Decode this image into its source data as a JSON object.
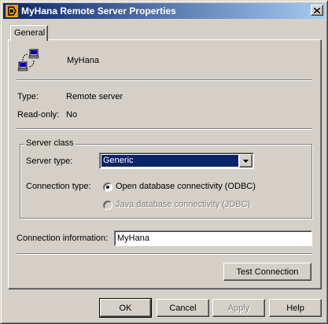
{
  "window": {
    "title": "MyHana Remote Server Properties"
  },
  "tabs": [
    {
      "label": "General"
    }
  ],
  "general": {
    "server_name": "MyHana",
    "type_label": "Type:",
    "type_value": "Remote server",
    "readonly_label": "Read-only:",
    "readonly_value": "No"
  },
  "server_class": {
    "group_label": "Server class",
    "server_type_label": "Server type:",
    "server_type_value": "Generic",
    "connection_type_label": "Connection type:",
    "options": [
      {
        "label": "Open database connectivity (ODBC)",
        "selected": true,
        "enabled": true
      },
      {
        "label": "Java database connectivity (JDBC)",
        "selected": false,
        "enabled": false
      }
    ]
  },
  "connection": {
    "label": "Connection information:",
    "value": "MyHana"
  },
  "buttons": {
    "test_connection": "Test Connection",
    "ok": "OK",
    "cancel": "Cancel",
    "apply": "Apply",
    "help": "Help"
  },
  "icons": {
    "title": "sybase-central-icon",
    "server": "remote-server-icon",
    "close": "close-icon",
    "dropdown": "chevron-down-icon"
  }
}
